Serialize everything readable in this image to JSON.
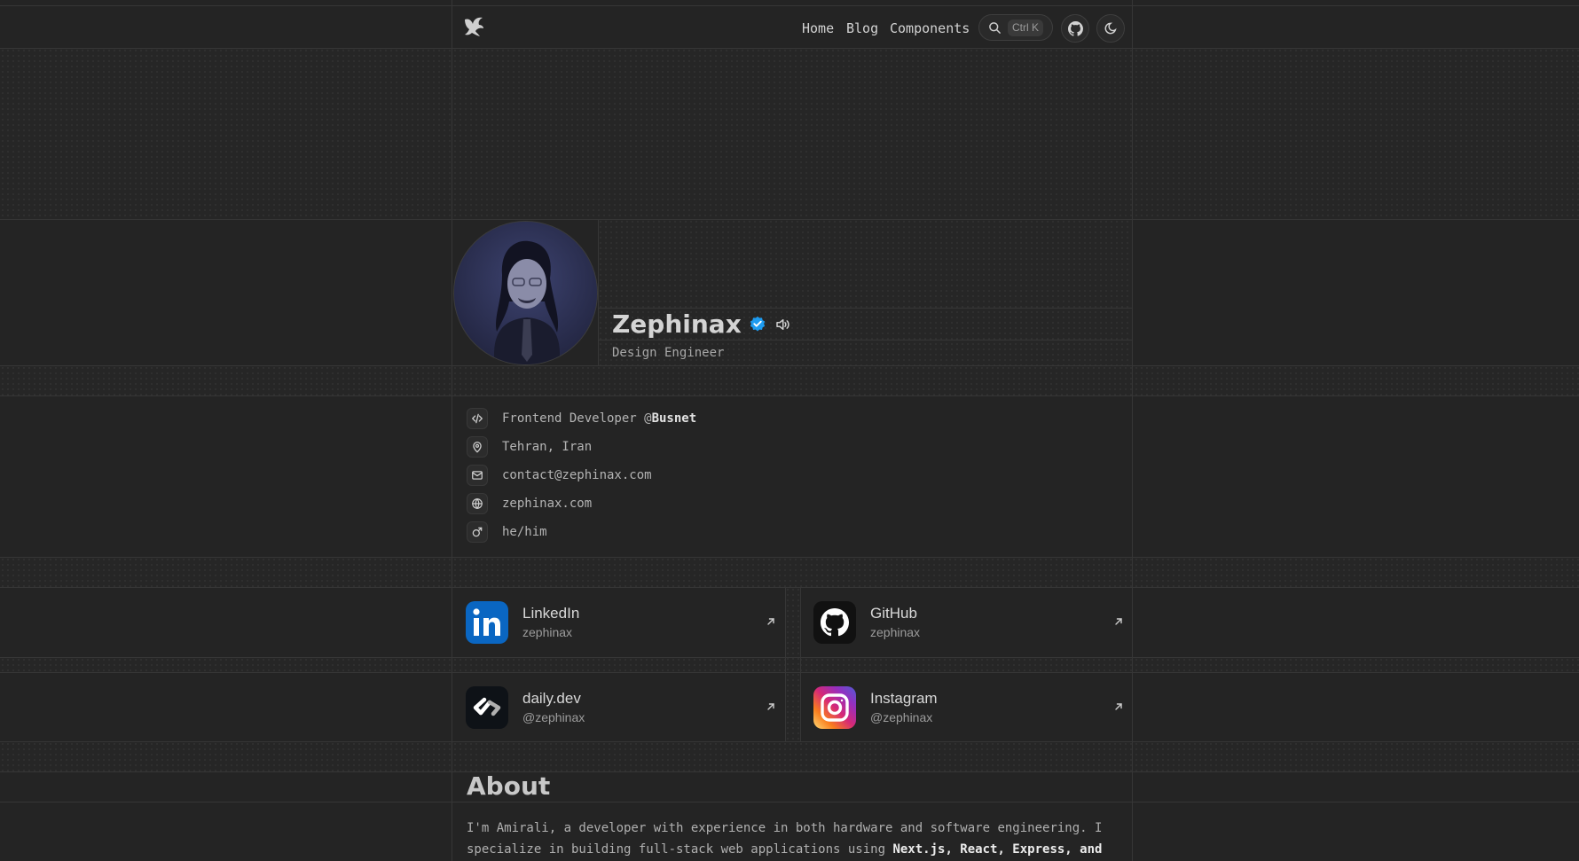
{
  "header": {
    "logo_icon": "phoenix-logo-icon",
    "nav": [
      "Home",
      "Blog",
      "Components"
    ],
    "search_shortcut": "Ctrl K",
    "github_icon": "github-icon",
    "theme_icon": "theme-toggle-icon"
  },
  "profile": {
    "name": "Zephinax",
    "role": "Design Engineer",
    "verified_color": "#1d9bf0"
  },
  "info": [
    {
      "icon": "code-icon",
      "text": "Frontend Developer @",
      "bold": "Busnet"
    },
    {
      "icon": "map-pin-icon",
      "text": "Tehran, Iran"
    },
    {
      "icon": "mail-icon",
      "text": "contact@zephinax.com"
    },
    {
      "icon": "globe-icon",
      "text": "zephinax.com"
    },
    {
      "icon": "male-icon",
      "text": "he/him"
    }
  ],
  "socials": [
    {
      "title": "LinkedIn",
      "handle": "zephinax",
      "color": "#0a66c2"
    },
    {
      "title": "GitHub",
      "handle": "zephinax",
      "color": "#111111"
    },
    {
      "title": "daily.dev",
      "handle": "@zephinax",
      "color": "#0e1217"
    },
    {
      "title": "Instagram",
      "handle": "@zephinax",
      "color": "#e1306c"
    }
  ],
  "about": {
    "heading": "About",
    "text": "I'm Amirali, a developer with experience in both hardware and software engineering. I specialize in building full-stack web applications using ",
    "bold": "Next.js, React, Express, and"
  }
}
